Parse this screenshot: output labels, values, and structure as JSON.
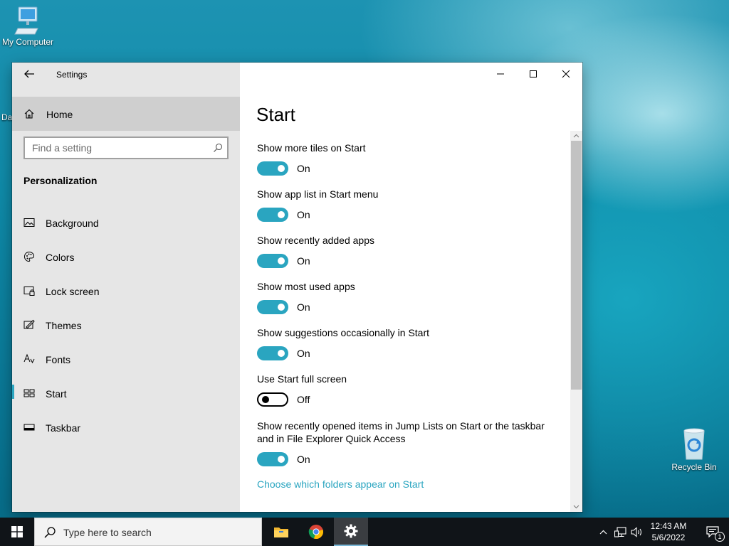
{
  "desktop": {
    "icons": [
      {
        "label": "My Computer"
      },
      {
        "label": "Recycle Bin"
      }
    ],
    "clipped_label": "Da"
  },
  "window": {
    "title": "Settings",
    "home_label": "Home",
    "search_placeholder": "Find a setting",
    "section_heading": "Personalization",
    "nav_items": [
      {
        "label": "Background",
        "icon": "picture-icon"
      },
      {
        "label": "Colors",
        "icon": "palette-icon"
      },
      {
        "label": "Lock screen",
        "icon": "lock-screen-icon"
      },
      {
        "label": "Themes",
        "icon": "themes-icon"
      },
      {
        "label": "Fonts",
        "icon": "fonts-icon"
      },
      {
        "label": "Start",
        "icon": "start-tiles-icon",
        "selected": true
      },
      {
        "label": "Taskbar",
        "icon": "taskbar-icon"
      }
    ]
  },
  "content": {
    "page_title": "Start",
    "settings": [
      {
        "label": "Show more tiles on Start",
        "state": "On"
      },
      {
        "label": "Show app list in Start menu",
        "state": "On"
      },
      {
        "label": "Show recently added apps",
        "state": "On"
      },
      {
        "label": "Show most used apps",
        "state": "On"
      },
      {
        "label": "Show suggestions occasionally in Start",
        "state": "On"
      },
      {
        "label": "Use Start full screen",
        "state": "Off"
      },
      {
        "label": "Show recently opened items in Jump Lists on Start or the taskbar and in File Explorer Quick Access",
        "state": "On"
      }
    ],
    "link": "Choose which folders appear on Start"
  },
  "taskbar": {
    "search_text": "Type here to search",
    "apps": [
      "file-explorer-icon",
      "chrome-icon",
      "settings-gear-icon"
    ],
    "time": "12:43 AM",
    "date": "5/6/2022",
    "notification_count": "1"
  },
  "colors": {
    "accent": "#2aa5c0",
    "sidebar_bg": "#e6e6e6",
    "taskbar_bg": "#101418"
  }
}
